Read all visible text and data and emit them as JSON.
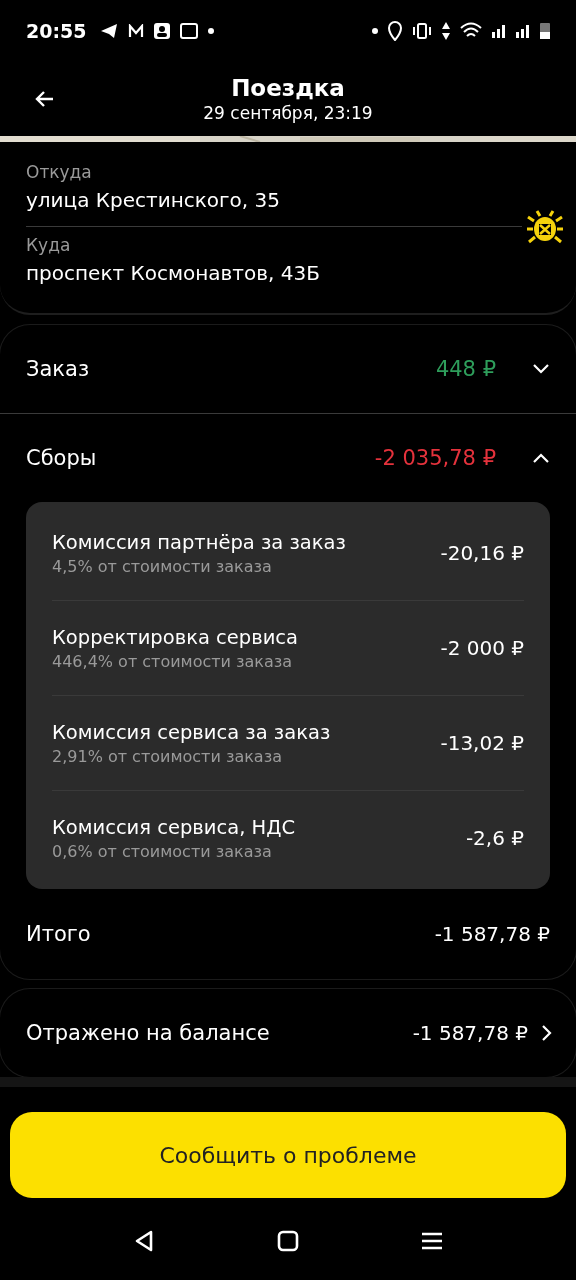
{
  "status_bar": {
    "time": "20:55"
  },
  "header": {
    "title": "Поездка",
    "subtitle": "29 сентября, 23:19"
  },
  "route": [
    {
      "label": "Откуда",
      "address": "улица Крестинского, 35"
    },
    {
      "label": "Куда",
      "address": "проспект Космонавтов, 43Б"
    }
  ],
  "sections": [
    {
      "label": "Заказ",
      "amount": "448 ₽",
      "color": "#2e9e5b",
      "expanded": false
    },
    {
      "label": "Сборы",
      "amount": "-2 035,78 ₽",
      "color": "#e5323c",
      "expanded": true,
      "items": [
        {
          "title": "Комиссия партнёра за заказ",
          "note": "4,5% от стоимости заказа",
          "amount": "-20,16 ₽"
        },
        {
          "title": "Корректировка сервиса",
          "note": "446,4% от стоимости заказа",
          "amount": "-2 000 ₽"
        },
        {
          "title": "Комиссия сервиса за заказ",
          "note": "2,91% от стоимости заказа",
          "amount": "-13,02 ₽"
        },
        {
          "title": "Комиссия сервиса, НДС",
          "note": "0,6% от стоимости заказа",
          "amount": "-2,6 ₽"
        }
      ]
    }
  ],
  "total": {
    "label": "Итого",
    "amount": "-1 587,78 ₽"
  },
  "balance": {
    "label": "Отражено на балансе",
    "amount": "-1 587,78 ₽"
  },
  "report_button": "Сообщить о проблеме"
}
